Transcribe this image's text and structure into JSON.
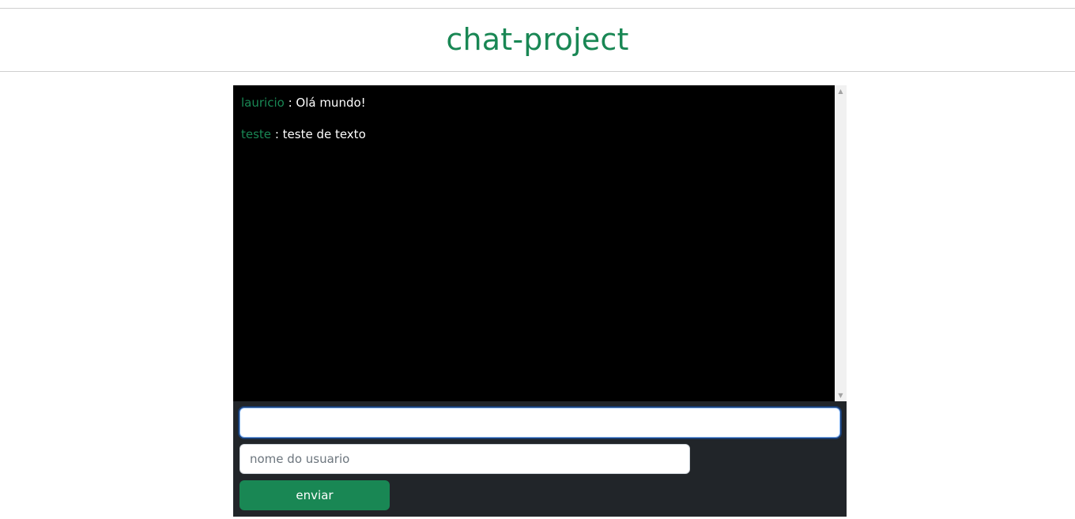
{
  "header": {
    "title": "chat-project"
  },
  "messages": [
    {
      "user": "lauricio",
      "separator": " : ",
      "text": "Olá mundo!"
    },
    {
      "user": "teste",
      "separator": " : ",
      "text": "teste de texto"
    }
  ],
  "form": {
    "message_value": "",
    "username_placeholder": "nome do usuario",
    "send_label": "enviar"
  },
  "colors": {
    "accent": "#198754",
    "chat_background": "#000000",
    "form_background": "#212529"
  }
}
